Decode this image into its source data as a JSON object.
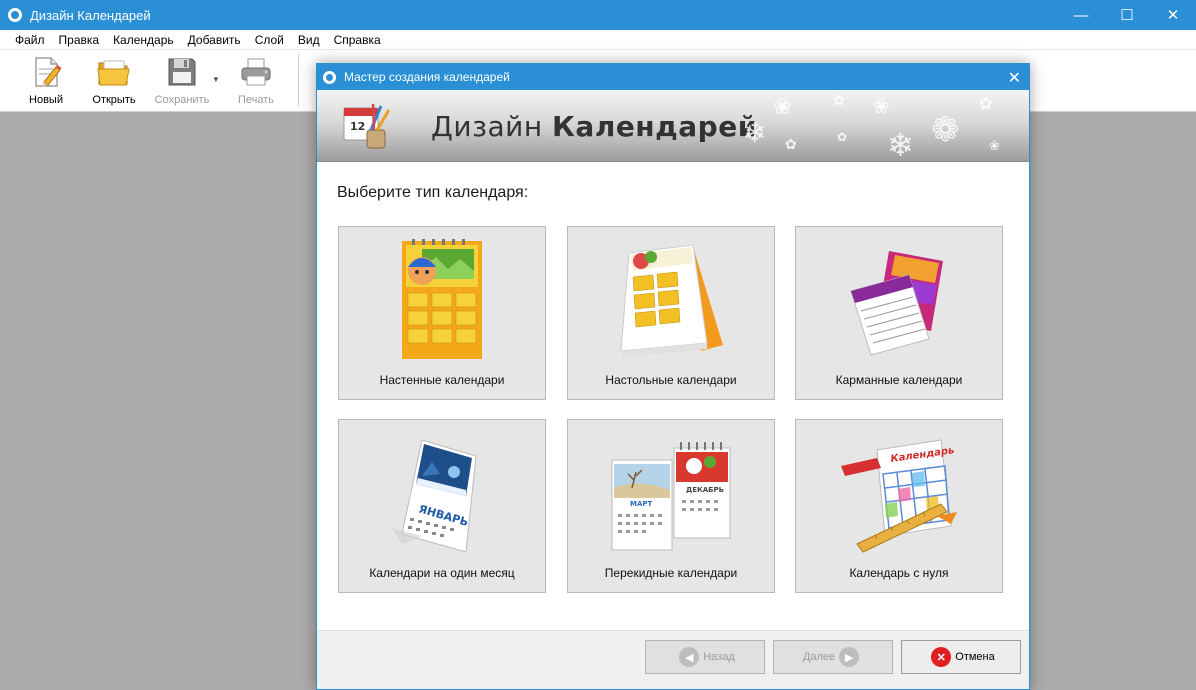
{
  "window": {
    "title": "Дизайн Календарей",
    "buttons": {
      "minimize": "—",
      "maximize": "☐",
      "close": "✕"
    }
  },
  "menu": [
    "Файл",
    "Правка",
    "Календарь",
    "Добавить",
    "Слой",
    "Вид",
    "Справка"
  ],
  "toolbar": {
    "new_label": "Новый",
    "open_label": "Открыть",
    "save_label": "Сохранить",
    "print_label": "Печать"
  },
  "dialog": {
    "title": "Мастер создания календарей",
    "close": "✕",
    "banner": {
      "title_light": "Дизайн",
      "title_bold": "Календарей",
      "icon_day": "12"
    },
    "prompt": "Выберите тип календаря:",
    "types": [
      {
        "label": "Настенные календари",
        "icon": "wall-calendar-icon"
      },
      {
        "label": "Настольные календари",
        "icon": "desk-calendar-icon"
      },
      {
        "label": "Карманные календари",
        "icon": "pocket-calendar-icon"
      },
      {
        "label": "Календари на один месяц",
        "icon": "single-month-calendar-icon",
        "image_text": "ЯНВАРЬ"
      },
      {
        "label": "Перекидные календари",
        "icon": "flip-calendar-icon",
        "image_text_1": "МАРТ",
        "image_text_2": "ДЕКАБРЬ"
      },
      {
        "label": "Календарь с нуля",
        "icon": "blank-calendar-icon",
        "image_text": "Календарь"
      }
    ],
    "buttons": {
      "back": "Назад",
      "next": "Далее",
      "cancel": "Отмена"
    }
  },
  "colors": {
    "titlebar": "#2b8fd6",
    "workspace": "#ababab",
    "card_bg": "#e6e6e6",
    "cancel_icon": "#e02020"
  }
}
